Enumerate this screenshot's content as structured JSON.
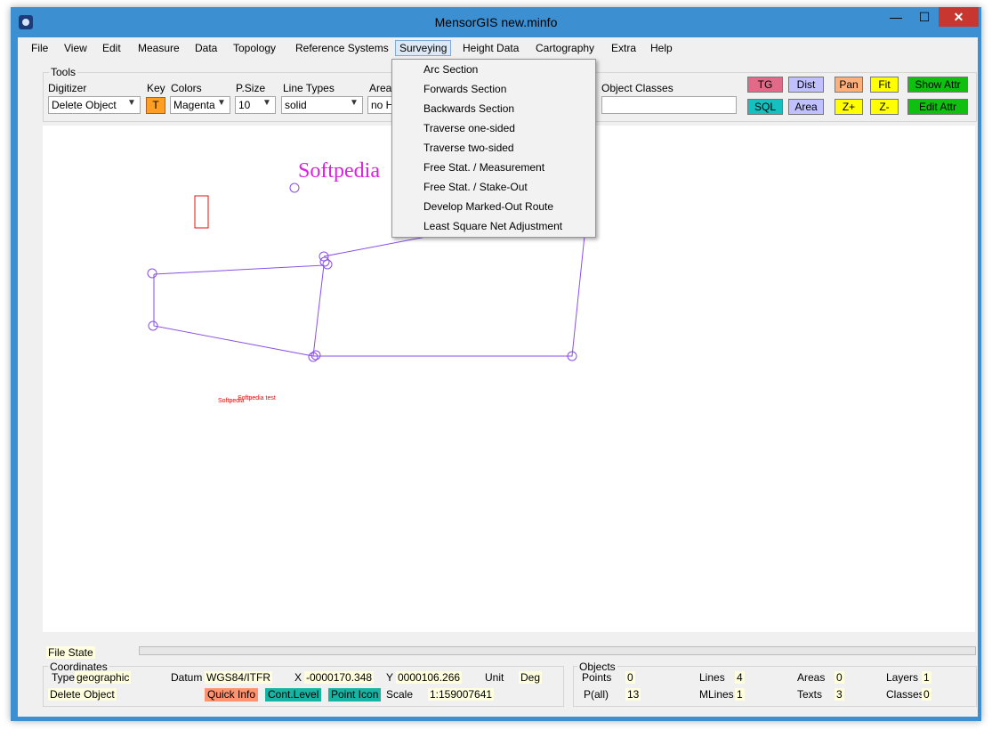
{
  "window": {
    "title": "MensorGIS new.minfo",
    "minimize": "—",
    "maximize": "☐",
    "close": "✕"
  },
  "menu": {
    "items": [
      "File",
      "View",
      "Edit",
      "Measure",
      "Data",
      "Topology",
      "Reference Systems",
      "Surveying",
      "Height Data",
      "Cartography",
      "Extra",
      "Help"
    ],
    "active": "Surveying"
  },
  "tools": {
    "group_title": "Tools",
    "digitizer_label": "Digitizer",
    "digitizer_value": "Delete Object",
    "key_label": "Key",
    "key_value": "T",
    "colors_label": "Colors",
    "colors_value": "Magenta",
    "psize_label": "P.Size",
    "psize_value": "10",
    "linetypes_label": "Line Types",
    "linetypes_value": "solid",
    "area_label": "Area",
    "area_value": "no H",
    "objclasses_label": "Object Classes",
    "objclasses_value": ""
  },
  "buttons": {
    "tg": "TG",
    "sql": "SQL",
    "dist": "Dist",
    "area": "Area",
    "pan": "Pan",
    "zplus": "Z+",
    "fit": "Fit",
    "zminus": "Z-",
    "show_attr": "Show Attr",
    "edit_attr": "Edit Attr"
  },
  "surveying_menu": [
    "Arc Section",
    "Forwards Section",
    "Backwards Section",
    "Traverse one-sided",
    "Traverse two-sided",
    "Free Stat. / Measurement",
    "Free Stat. / Stake-Out",
    "Develop Marked-Out Route",
    "Least Square Net Adjustment"
  ],
  "map": {
    "label_big": "Softpedia",
    "label_small_1": "Softpedia",
    "label_small_2": "Softpedia test"
  },
  "status": {
    "file_state_label": "File State",
    "coordinates_title": "Coordinates",
    "type_label": "Type",
    "type_value": "geographic",
    "datum_label": "Datum",
    "datum_value": "WGS84/ITFR",
    "x_label": "X",
    "x_value": "-0000170.348",
    "y_label": "Y",
    "y_value": "0000106.266",
    "unit_label": "Unit",
    "unit_value": "Deg",
    "mode_value": "Delete Object",
    "quick_info": "Quick Info",
    "cont_level": "Cont.Level",
    "point_icon": "Point Icon",
    "scale_label": "Scale",
    "scale_value": "1:159007641",
    "objects_title": "Objects",
    "points_label": "Points",
    "points_value": "0",
    "pall_label": "P(all)",
    "pall_value": "13",
    "lines_label": "Lines",
    "lines_value": "4",
    "mlines_label": "MLines",
    "mlines_value": "1",
    "areas_label": "Areas",
    "areas_value": "0",
    "texts_label": "Texts",
    "texts_value": "3",
    "layers_label": "Layers",
    "layers_value": "1",
    "classes_label": "Classes",
    "classes_value": "0"
  },
  "colors": {
    "line": "#8a4fe8",
    "magenta": "#e020e0",
    "red": "#e01010",
    "tg": "#e06a87",
    "sql": "#17c0c0",
    "lavender": "#c0c0ff",
    "orange": "#ffb07a",
    "yellow": "#ffff00",
    "green": "#10c010"
  }
}
